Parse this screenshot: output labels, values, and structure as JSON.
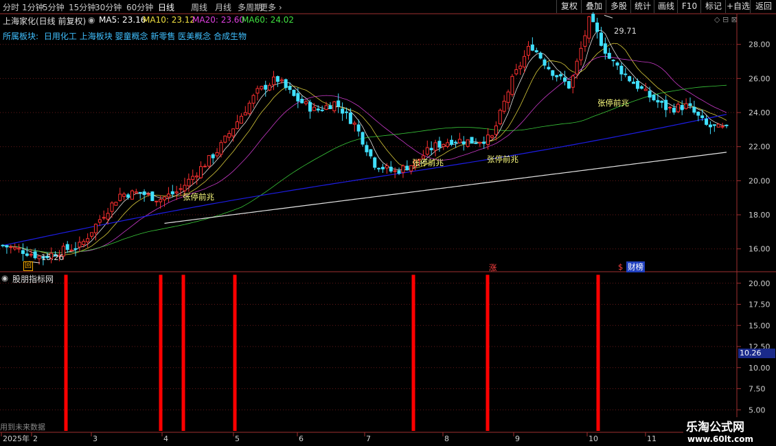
{
  "toolbar": {
    "periods": [
      "分时",
      "1分钟",
      "5分钟",
      "15分钟",
      "30分钟",
      "60分钟",
      "日线",
      "周线",
      "月线",
      "多周期",
      "更多"
    ],
    "active_period": "日线",
    "right_buttons": [
      "复权",
      "叠加",
      "多股",
      "统计",
      "画线",
      "F10",
      "标记",
      "+自选",
      "返回"
    ]
  },
  "info": {
    "title": "上海家化(日线 前复权)",
    "ma": [
      {
        "label": "MA5: 23.16",
        "color": "#ffffff"
      },
      {
        "label": "MA10: 23.12",
        "color": "#f0e040"
      },
      {
        "label": "MA20: 23.60",
        "color": "#e040e0"
      },
      {
        "label": "MA60: 24.02",
        "color": "#40e040"
      }
    ],
    "sector_prefix": "所属板块:",
    "sectors": "日用化工 上海板块 婴童概念 新零售 医美概念 合成生物"
  },
  "indicator_title": "股朋指标网",
  "future_data_note": "用到未来数据",
  "watermark": {
    "title": "乐淘公式网",
    "url": "www.60lt.com"
  },
  "badges": {
    "hui": "回",
    "zhang": "涨",
    "caibang": "财榜"
  },
  "colors": {
    "up": "#ff3030",
    "down": "#40e0ff",
    "ma5": "#ffffff",
    "ma10": "#f0e040",
    "ma20": "#e040e0",
    "ma60": "#40e040",
    "ma120": "#2020ff",
    "ma250": "#ffffff",
    "signal": "#ff0000",
    "label": "#ffff80"
  },
  "chart_data": [
    {
      "type": "candlestick",
      "y_axis": [
        16.0,
        18.0,
        20.0,
        22.0,
        24.0,
        26.0,
        28.0
      ],
      "ylim": [
        14.7,
        29.8
      ],
      "x_ticks": [
        "2025年",
        "2",
        "3",
        "4",
        "5",
        "6",
        "7",
        "8",
        "9",
        "10",
        "11"
      ],
      "annotations": [
        {
          "text": "29.71",
          "kind": "high"
        },
        {
          "text": "15.26",
          "kind": "low"
        },
        {
          "text": "张停前兆"
        },
        {
          "text": "张停前兆"
        },
        {
          "text": "张停前兆"
        },
        {
          "text": "张停前兆"
        }
      ],
      "close_path": [
        16.2,
        15.9,
        15.5,
        15.9,
        16.2,
        17.8,
        19.2,
        19.3,
        18.9,
        19.4,
        20.6,
        21.8,
        23.5,
        25.2,
        26.0,
        24.8,
        24.1,
        24.6,
        23.3,
        21.0,
        20.5,
        21.0,
        22.0,
        22.4,
        22.3,
        22.5,
        25.8,
        28.0,
        26.5,
        25.5,
        29.5,
        27.2,
        26.0,
        25.0,
        24.2,
        24.4,
        23.2,
        23.0
      ]
    },
    {
      "type": "bar",
      "title": "股朋指标网",
      "y_axis": [
        5.0,
        7.5,
        10.0,
        12.5,
        15.0,
        17.5,
        20.0
      ],
      "ylim": [
        2.5,
        21.2
      ],
      "current_value": "10.26",
      "signal_values": [
        21,
        21,
        21,
        21,
        21,
        21,
        21
      ],
      "signal_months": [
        "2",
        "3",
        "4",
        "5",
        "7",
        "8",
        "10"
      ]
    }
  ]
}
